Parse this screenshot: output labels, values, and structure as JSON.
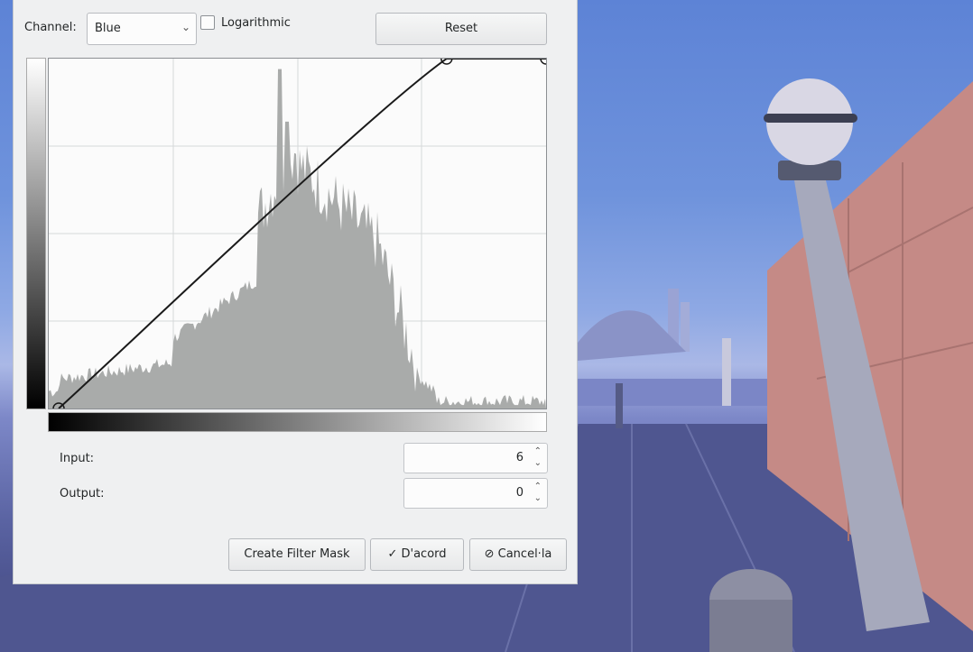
{
  "dialog": {
    "channel_label": "Channel:",
    "channel_value": "Blue",
    "logarithmic_label": "Logarithmic",
    "logarithmic_checked": false,
    "reset_label": "Reset",
    "input_label": "Input:",
    "input_value": "6",
    "output_label": "Output:",
    "output_value": "0",
    "create_filter_mask_label": "Create Filter Mask",
    "ok_label": "D'acord",
    "cancel_label": "Cancel·la"
  },
  "icons": {
    "combo_arrow": "chevron-down-icon",
    "ok": "check-icon",
    "cancel": "cancel-icon",
    "spin": "spin-arrows-icon"
  },
  "colors": {
    "dialog_bg": "#eff0f1",
    "histogram_fill": "#a9abaa",
    "curve": "#1a1a1a"
  },
  "curve_points": [
    {
      "input": 0.02,
      "output": 0.0
    },
    {
      "input": 0.8,
      "output": 1.0
    },
    {
      "input": 1.0,
      "output": 1.0
    }
  ]
}
